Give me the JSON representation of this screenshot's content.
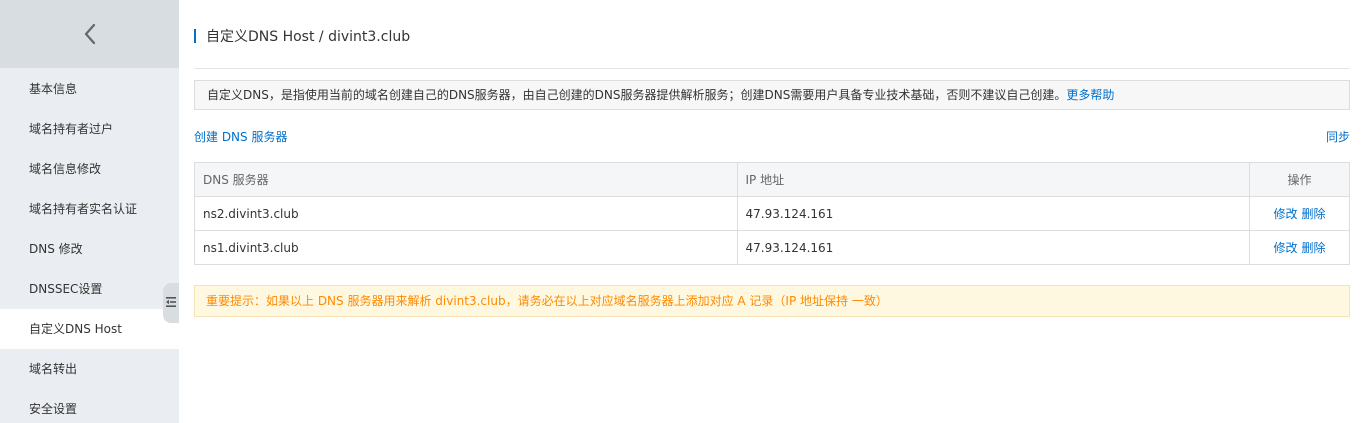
{
  "sidebar": {
    "back_icon": "chevron-left-icon",
    "collapse_icon": "collapse-menu-icon",
    "items": [
      {
        "label": "基本信息",
        "active": false
      },
      {
        "label": "域名持有者过户",
        "active": false
      },
      {
        "label": "域名信息修改",
        "active": false
      },
      {
        "label": "域名持有者实名认证",
        "active": false
      },
      {
        "label": "DNS 修改",
        "active": false
      },
      {
        "label": "DNSSEC设置",
        "active": false
      },
      {
        "label": "自定义DNS Host",
        "active": true
      },
      {
        "label": "域名转出",
        "active": false
      },
      {
        "label": "安全设置",
        "active": false
      }
    ]
  },
  "header": {
    "title": "自定义DNS Host / divint3.club"
  },
  "notice": {
    "text": "自定义DNS，是指使用当前的域名创建自己的DNS服务器，由自己创建的DNS服务器提供解析服务；创建DNS需要用户具备专业技术基础，否则不建议自己创建。",
    "help_link": "更多帮助"
  },
  "actions": {
    "create": "创建 DNS 服务器",
    "sync": "同步"
  },
  "table": {
    "headers": {
      "server": "DNS 服务器",
      "ip": "IP 地址",
      "op": "操作"
    },
    "rows": [
      {
        "server": "ns2.divint3.club",
        "ip": "47.93.124.161",
        "edit": "修改",
        "delete": "删除"
      },
      {
        "server": "ns1.divint3.club",
        "ip": "47.93.124.161",
        "edit": "修改",
        "delete": "删除"
      }
    ]
  },
  "warning": {
    "text": "重要提示：如果以上 DNS 服务器用来解析 divint3.club，请务必在以上对应域名服务器上添加对应 A 记录（IP 地址保持 一致）"
  },
  "colors": {
    "accent": "#0070cc",
    "warning_text": "#ff8a00",
    "sidebar_bg": "#eaedf1"
  }
}
